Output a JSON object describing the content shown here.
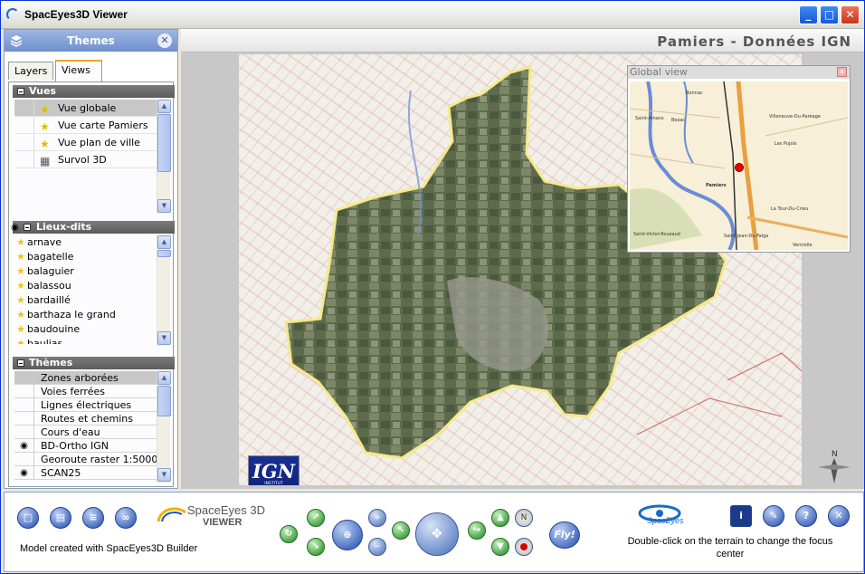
{
  "window": {
    "title": "SpacEyes3D Viewer"
  },
  "panel": {
    "title": "Themes"
  },
  "tabs": [
    {
      "label": "Layers"
    },
    {
      "label": "Views",
      "active": true
    }
  ],
  "vues": {
    "header": "Vues",
    "items": [
      {
        "label": "Vue globale",
        "selected": true,
        "icon": "star-icon"
      },
      {
        "label": "Vue carte Pamiers",
        "icon": "star-icon"
      },
      {
        "label": "Vue plan de ville",
        "icon": "star-icon"
      },
      {
        "label": "Survol 3D",
        "icon": "film-icon"
      }
    ]
  },
  "lieux": {
    "header": "Lieux-dits",
    "items": [
      "arnave",
      "bagatelle",
      "balaguier",
      "balassou",
      "bardaillé",
      "barthaza le grand",
      "baudouine",
      "baulias"
    ]
  },
  "themes": {
    "header": "Thèmes",
    "items": [
      {
        "label": "Zones arborées",
        "selected": true,
        "visible": false
      },
      {
        "label": "Voies ferrées",
        "visible": false
      },
      {
        "label": "Lignes électriques",
        "visible": false
      },
      {
        "label": "Routes et chemins",
        "visible": false
      },
      {
        "label": "Cours d'eau",
        "visible": false
      },
      {
        "label": "BD-Ortho IGN",
        "visible": true
      },
      {
        "label": "Georoute raster 1:5000",
        "visible": false
      },
      {
        "label": "SCAN25",
        "visible": true
      }
    ]
  },
  "main": {
    "title": "Pamiers - Données IGN"
  },
  "global_view": {
    "title": "Global view",
    "labels": [
      "Bonnac",
      "Saint-Amans",
      "Bezac",
      "Villeneuve-Du-Paréage",
      "Les Pujols",
      "Pamiers",
      "La Tour-Du-Crieu",
      "Saint-Victor-Rouzaud",
      "Saint-Jean-Du-Falga",
      "Verniolle"
    ]
  },
  "logo": {
    "line1": "IGN",
    "line2": "INSTITUT GÉOGRAPHIQUE NATIONAL"
  },
  "bottom": {
    "brand_name": "SpaceEyes 3D",
    "brand_sub": "VIEWER",
    "model_caption": "Model created with SpacEyes3D Builder",
    "fly_label": "Fly!",
    "spaceyes_logo": "SpacEyes",
    "hint": "Double-click on the terrain to change the focus center"
  },
  "colors": {
    "panel_header": "#7f9ad4",
    "group_header": "#6a6a6a",
    "accent_tab": "#f5a623"
  }
}
